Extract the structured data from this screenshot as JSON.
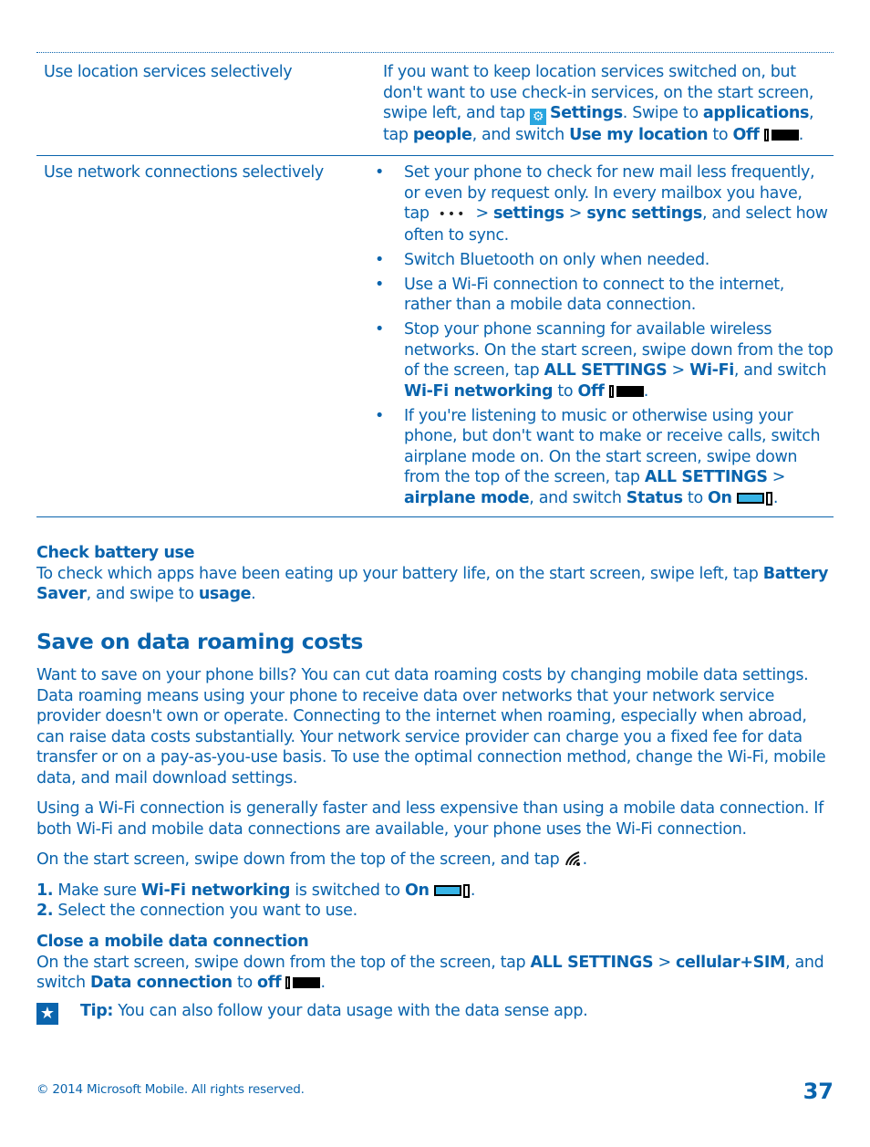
{
  "table": {
    "rows": [
      {
        "label": "Use location services selectively",
        "text_parts": {
          "t1": "If you want to keep location services switched on, but don't want to use check-in services, on the start screen, swipe left, and tap ",
          "settings": "Settings",
          "t2": ". Swipe to ",
          "applications": "applications",
          "t3": ", tap ",
          "people": "people",
          "t4": ", and switch ",
          "use_my_location": "Use my location",
          "t5": " to ",
          "off": "Off",
          "t6": "."
        }
      },
      {
        "label": "Use network connections selectively",
        "bullets": [
          {
            "t1": "Set your phone to check for new mail less frequently, or even by request only. In every mailbox you have, tap",
            "more": "•••",
            "t2": "> ",
            "settings": "settings",
            "t3": " > ",
            "sync_settings": "sync settings",
            "t4": ", and select how often to sync."
          },
          {
            "text": "Switch Bluetooth on only when needed."
          },
          {
            "text": "Use a Wi-Fi connection to connect to the internet, rather than a mobile data connection."
          },
          {
            "t1": "Stop your phone scanning for available wireless networks. On the start screen, swipe down from the top of the screen, tap ",
            "all_settings": "ALL SETTINGS",
            "t2": " > ",
            "wifi": "Wi-Fi",
            "t3": ", and switch ",
            "wifi_networking": "Wi-Fi networking",
            "t4": " to ",
            "off": "Off",
            "t5": "."
          },
          {
            "t1": "If you're listening to music or otherwise using your phone, but don't want to make or receive calls, switch airplane mode on. On the start screen, swipe down from the top of the screen, tap ",
            "all_settings": "ALL SETTINGS",
            "t2": " > ",
            "airplane_mode": "airplane mode",
            "t3": ", and switch ",
            "status": "Status",
            "t4": " to ",
            "on": "On",
            "t5": "."
          }
        ]
      }
    ]
  },
  "check_battery": {
    "heading": "Check battery use",
    "t1": "To check which apps have been eating up your battery life, on the start screen, swipe left, tap ",
    "battery_saver": "Battery Saver",
    "t2": ", and swipe to ",
    "usage": "usage",
    "t3": "."
  },
  "roaming": {
    "heading": "Save on data roaming costs",
    "para1": "Want to save on your phone bills? You can cut data roaming costs by changing mobile data settings. Data roaming means using your phone to receive data over networks that your network service provider doesn't own or operate. Connecting to the internet when roaming, especially when abroad, can raise data costs substantially. Your network service provider can charge you a fixed fee for data transfer or on a pay-as-you-use basis. To use the optimal connection method, change the Wi-Fi, mobile data, and mail download settings.",
    "para2": "Using a Wi-Fi connection is generally faster and less expensive than using a mobile data connection. If both Wi-Fi and mobile data connections are available, your phone uses the Wi-Fi connection.",
    "para3": "On the start screen, swipe down from the top of the screen, and tap ",
    "para3_end": ".",
    "step1": {
      "num": "1.",
      "t1": " Make sure ",
      "wifi_networking": "Wi-Fi networking",
      "t2": " is switched to ",
      "on": "On",
      "t3": "."
    },
    "step2": {
      "num": "2.",
      "t1": " Select the connection you want to use."
    }
  },
  "close_data": {
    "heading": "Close a mobile data connection",
    "t1": "On the start screen, swipe down from the top of the screen, tap ",
    "all_settings": "ALL SETTINGS",
    "t2": " > ",
    "cellular": "cellular+SIM",
    "t3": ", and switch ",
    "data_connection": "Data connection",
    "t4": " to ",
    "off": "off",
    "t5": "."
  },
  "tip": {
    "label": "Tip:",
    "text": " You can also follow your data usage with the data sense app."
  },
  "footer": {
    "copyright": "© 2014 Microsoft Mobile. All rights reserved.",
    "page_number": "37"
  },
  "colors": {
    "text": "#0a64ad",
    "toggle_on": "#38b4e6",
    "settings_icon": "#2aa6df"
  }
}
